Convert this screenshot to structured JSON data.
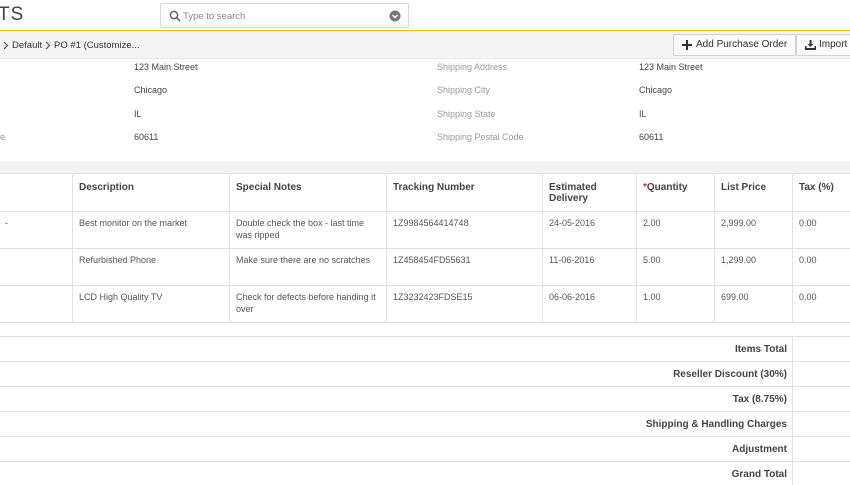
{
  "header": {
    "app_title": "TS",
    "search": {
      "placeholder": "Type to search",
      "value": ""
    }
  },
  "breadcrumb": {
    "items": [
      "Default",
      "PO #1 (Customize..."
    ]
  },
  "toolbar": {
    "add_purchase_order": "Add Purchase Order",
    "import": "Import"
  },
  "address": {
    "left": [
      {
        "label": "",
        "value": "123 Main Street"
      },
      {
        "label": "",
        "value": "Chicago"
      },
      {
        "label": "",
        "value": "IL"
      },
      {
        "label": "le",
        "value": "60611"
      }
    ],
    "right": [
      {
        "label": "Shipping Address",
        "value": "123 Main Street"
      },
      {
        "label": "Shipping City",
        "value": "Chicago"
      },
      {
        "label": "Shipping State",
        "value": "IL"
      },
      {
        "label": "Shipping Postal Code",
        "value": "60611"
      }
    ]
  },
  "items_table": {
    "columns": [
      "",
      "Description",
      "Special Notes",
      "Tracking Number",
      "Estimated Delivery",
      "Quantity",
      "List Price",
      "Tax (%)"
    ],
    "required_marker": "*",
    "rows": [
      {
        "lead": "-",
        "description": "Best monitor on the market",
        "notes": "Double check the box - last time was ripped",
        "tracking": "1Z9984564414748",
        "delivery": "24-05-2016",
        "quantity": "2.00",
        "price": "2,999.00",
        "tax": "0.00"
      },
      {
        "lead": "",
        "description": "Refurbished Phone",
        "notes": "Make sure there are no scratches",
        "tracking": "1Z458454FD55631",
        "delivery": "11-06-2016",
        "quantity": "5.00",
        "price": "1,299.00",
        "tax": "0.00"
      },
      {
        "lead": "",
        "description": "LCD High Quality TV",
        "notes": "Check for defects before handing it over",
        "tracking": "1Z3232423FDSE15",
        "delivery": "06-06-2016",
        "quantity": "1.00",
        "price": "699.00",
        "tax": "0.00"
      }
    ]
  },
  "totals": [
    "Items Total",
    "Reseller Discount (30%)",
    "Tax (8.75%)",
    "Shipping & Handling Charges",
    "Adjustment",
    "Grand Total"
  ],
  "colors": {
    "accent_line": "#f0c000",
    "required": "#e03030"
  }
}
